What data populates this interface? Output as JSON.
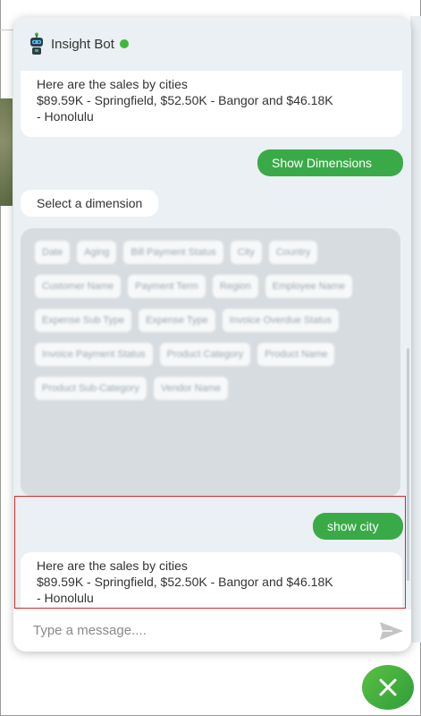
{
  "header": {
    "bot_name": "Insight Bot",
    "status_color": "#3db83a"
  },
  "messages": {
    "bot_1": {
      "line1": "Here are the sales by cities",
      "line2": "$89.59K - Springfield, $52.50K - Bangor and $46.18K",
      "line3": "- Honolulu"
    },
    "user_1": "Show Dimensions",
    "bot_2": "Select a dimension",
    "user_2": "show city",
    "bot_3": {
      "line1": "Here are the sales by cities",
      "line2": "$89.59K - Springfield, $52.50K - Bangor and $46.18K",
      "line3": "- Honolulu"
    }
  },
  "dimensions": [
    "Date",
    "Aging",
    "Bill Payment Status",
    "City",
    "Country",
    "Customer Name",
    "Payment Term",
    "Region",
    "Employee Name",
    "Expense Sub Type",
    "Expense Type",
    "Invoice Overdue Status",
    "Invoice Payment Status",
    "Product Category",
    "Product Name",
    "Product Sub-Category",
    "Vendor Name"
  ],
  "input": {
    "placeholder": "Type a message...."
  },
  "colors": {
    "accent": "#3aaa48",
    "highlight_border": "#d62b2b",
    "panel_bg": "#eaf0f3"
  },
  "icons": {
    "avatar": "robot-icon",
    "send": "send-icon",
    "close": "close-icon"
  }
}
